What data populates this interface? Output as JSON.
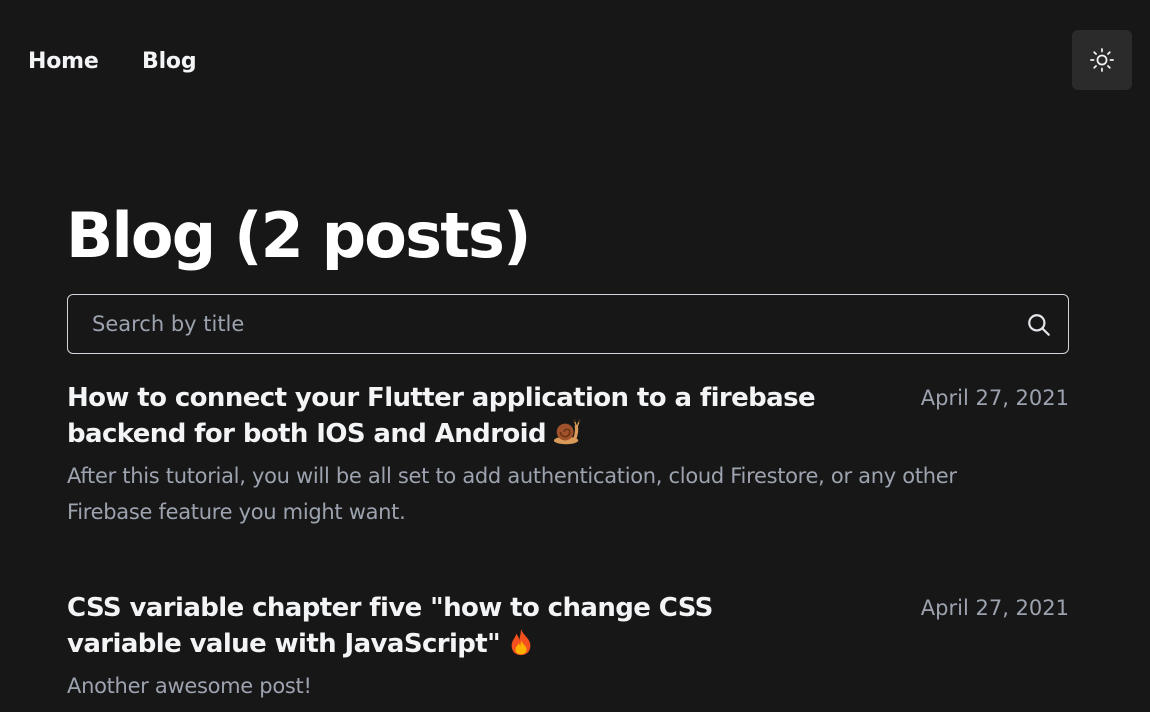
{
  "nav": {
    "home_label": "Home",
    "blog_label": "Blog",
    "theme_toggle_icon": "sun-icon"
  },
  "page": {
    "title": "Blog (2 posts)"
  },
  "search": {
    "placeholder": "Search by title",
    "value": "",
    "icon": "search-icon"
  },
  "posts": [
    {
      "title": "How to connect your Flutter application to a firebase backend for both IOS and Android",
      "emoji": "snail-icon",
      "date": "April 27, 2021",
      "summary": "After this tutorial, you will be all set to add authentication, cloud Firestore, or any other Firebase feature you might want."
    },
    {
      "title": "CSS variable chapter five \"how to change CSS variable value with JavaScript\"",
      "emoji": "fire-icon",
      "date": "April 27, 2021",
      "summary": "Another awesome post!"
    }
  ],
  "colors": {
    "background": "#171717",
    "text_primary": "#f3f4f6",
    "text_muted": "#9ca3af",
    "toggle_bg": "#2b2b2b",
    "border": "#d1d5db"
  }
}
